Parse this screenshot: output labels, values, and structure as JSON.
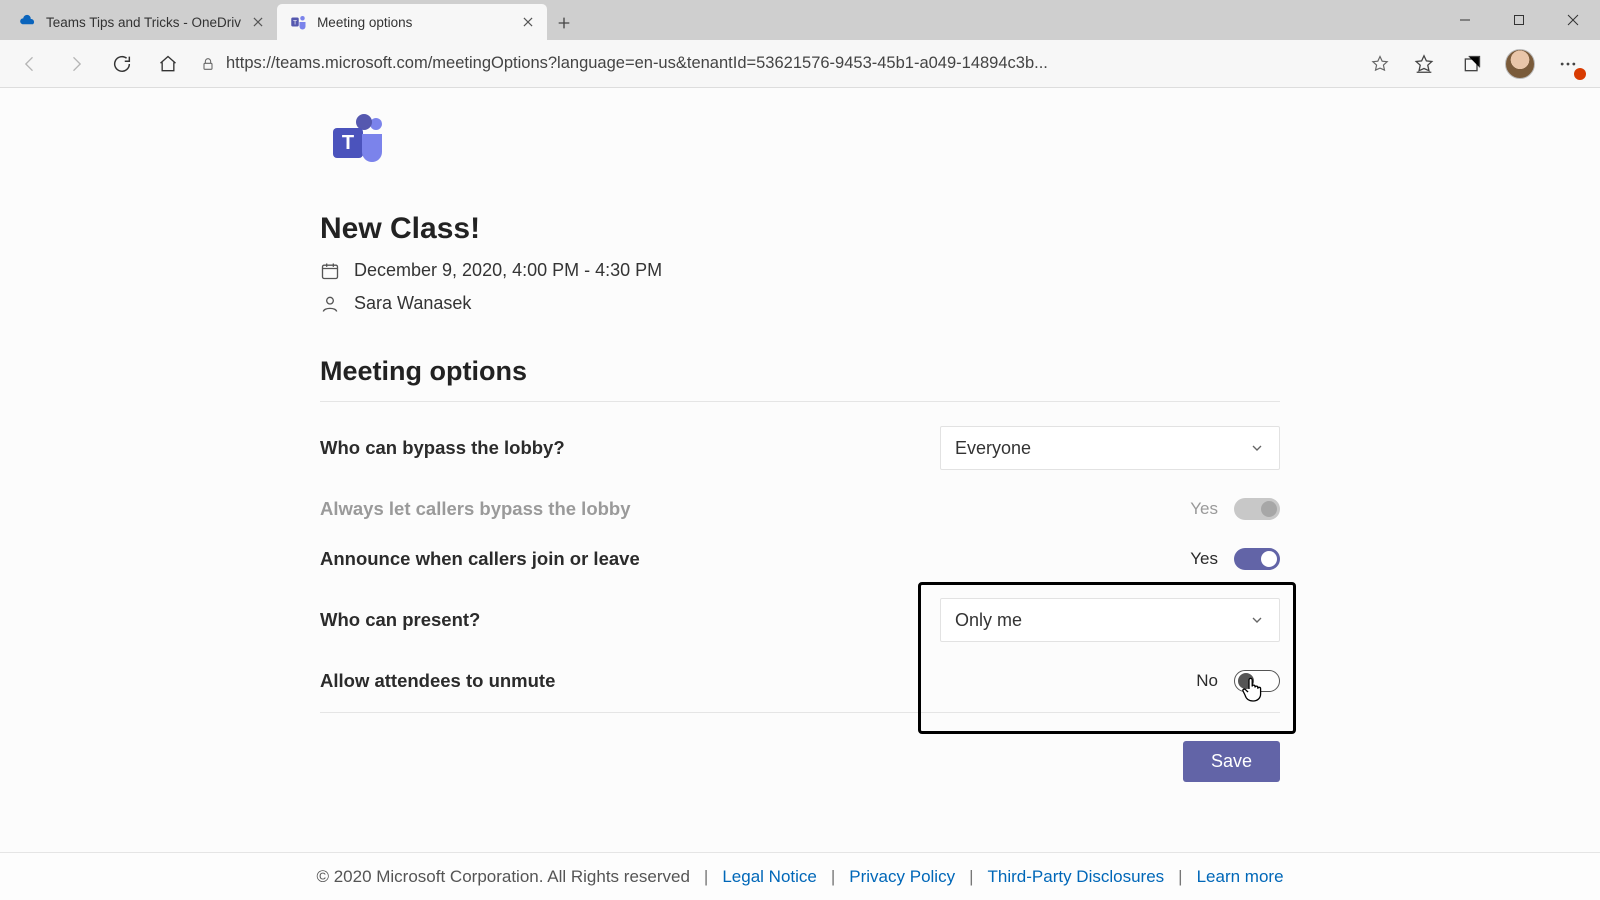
{
  "browser": {
    "tabs": [
      {
        "title": "Teams Tips and Tricks - OneDriv",
        "active": false,
        "icon": "onedrive"
      },
      {
        "title": "Meeting options",
        "active": true,
        "icon": "teams"
      }
    ],
    "url": "https://teams.microsoft.com/meetingOptions?language=en-us&tenantId=53621576-9453-45b1-a049-14894c3b..."
  },
  "meeting": {
    "title": "New Class!",
    "datetime": "December 9, 2020, 4:00 PM - 4:30 PM",
    "organizer": "Sara Wanasek"
  },
  "section_heading": "Meeting options",
  "options": {
    "bypass_lobby": {
      "label": "Who can bypass the lobby?",
      "value": "Everyone"
    },
    "callers_bypass": {
      "label": "Always let callers bypass the lobby",
      "value": "Yes"
    },
    "announce": {
      "label": "Announce when callers join or leave",
      "value": "Yes"
    },
    "present": {
      "label": "Who can present?",
      "value": "Only me"
    },
    "unmute": {
      "label": "Allow attendees to unmute",
      "value": "No"
    }
  },
  "save_label": "Save",
  "footer": {
    "copyright": "© 2020 Microsoft Corporation. All Rights reserved",
    "links": [
      "Legal Notice",
      "Privacy Policy",
      "Third-Party Disclosures",
      "Learn more"
    ]
  }
}
